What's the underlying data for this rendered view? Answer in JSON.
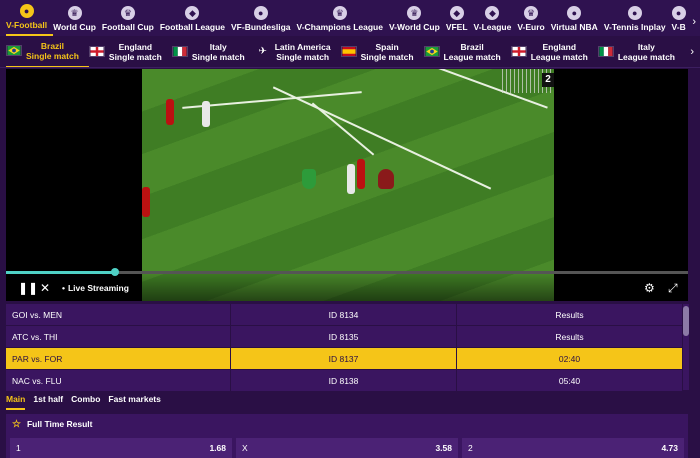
{
  "topnav": {
    "items": [
      {
        "label": "V-Football",
        "icon": "soccer-ball-icon",
        "active": true
      },
      {
        "label": "World Cup",
        "icon": "trophy-icon"
      },
      {
        "label": "Football Cup",
        "icon": "cup-icon"
      },
      {
        "label": "Football League",
        "icon": "shield-icon"
      },
      {
        "label": "VF-Bundesliga",
        "icon": "ball-icon"
      },
      {
        "label": "V-Champions League",
        "icon": "trophy-icon"
      },
      {
        "label": "V-World Cup",
        "icon": "trophy-icon"
      },
      {
        "label": "VFEL",
        "icon": "shield-icon"
      },
      {
        "label": "V-League",
        "icon": "shield-icon"
      },
      {
        "label": "V-Euro",
        "icon": "trophy-icon"
      },
      {
        "label": "Virtual NBA",
        "icon": "basketball-icon"
      },
      {
        "label": "V-Tennis Inplay",
        "icon": "tennis-ball-icon"
      },
      {
        "label": "V-B",
        "icon": "ball-icon"
      }
    ]
  },
  "leagues": [
    {
      "line1": "Brazil",
      "line2": "Single match",
      "flag": "brazil",
      "active": true
    },
    {
      "line1": "England",
      "line2": "Single match",
      "flag": "england"
    },
    {
      "line1": "Italy",
      "line2": "Single match",
      "flag": "italy"
    },
    {
      "line1": "Latin America",
      "line2": "Single match",
      "flag": "latam"
    },
    {
      "line1": "Spain",
      "line2": "Single match",
      "flag": "spain"
    },
    {
      "line1": "Brazil",
      "line2": "League match",
      "flag": "brazil"
    },
    {
      "line1": "England",
      "line2": "League match",
      "flag": "england"
    },
    {
      "line1": "Italy",
      "line2": "League match",
      "flag": "italy"
    }
  ],
  "player": {
    "live_label": "Live Streaming",
    "score": "2",
    "progress_fraction": 0.16
  },
  "matches": [
    {
      "teams": "GOI vs. MEN",
      "id": "ID 8134",
      "status": "Results"
    },
    {
      "teams": "ATC vs. THI",
      "id": "ID 8135",
      "status": "Results"
    },
    {
      "teams": "PAR vs. FOR",
      "id": "ID 8137",
      "status": "02:40",
      "selected": true
    },
    {
      "teams": "NAC vs. FLU",
      "id": "ID 8138",
      "status": "05:40"
    }
  ],
  "market_tabs": [
    {
      "label": "Main",
      "active": true
    },
    {
      "label": "1st half"
    },
    {
      "label": "Combo"
    },
    {
      "label": "Fast markets"
    }
  ],
  "full_time_result": {
    "title": "Full Time Result",
    "odds": [
      {
        "label": "1",
        "value": "1.68"
      },
      {
        "label": "X",
        "value": "3.58"
      },
      {
        "label": "2",
        "value": "4.73"
      }
    ]
  },
  "colors": {
    "accent": "#f5c518",
    "background": "#2a0f45",
    "row": "#3a1560",
    "progress": "#4fd1c5"
  }
}
